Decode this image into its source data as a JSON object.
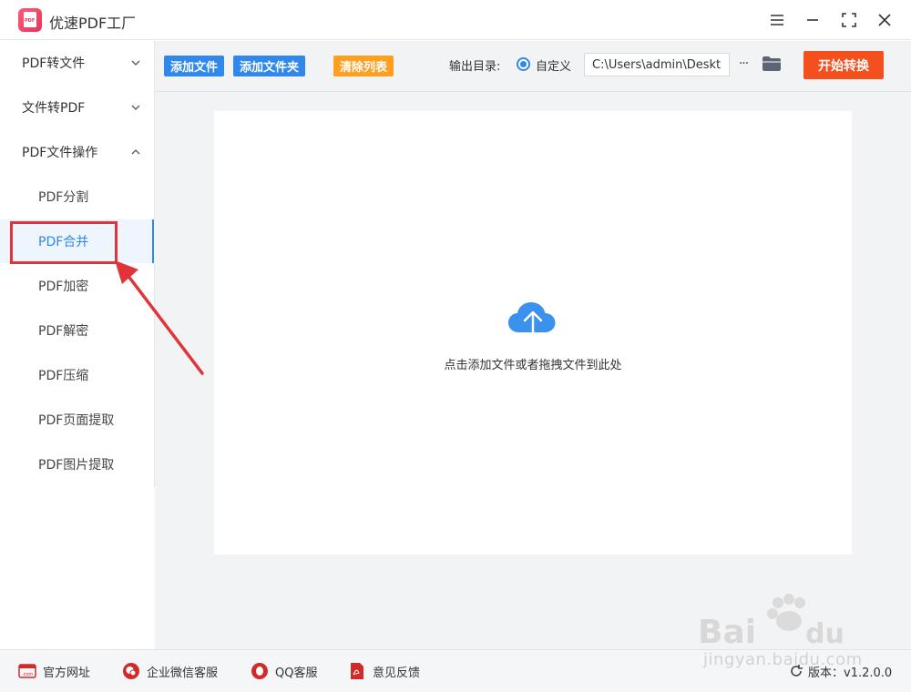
{
  "app": {
    "title": "优速PDF工厂"
  },
  "sidebar": {
    "groups": [
      {
        "label": "PDF转文件",
        "expanded": false
      },
      {
        "label": "文件转PDF",
        "expanded": false
      },
      {
        "label": "PDF文件操作",
        "expanded": true
      }
    ],
    "items": [
      {
        "label": "PDF分割"
      },
      {
        "label": "PDF合并",
        "active": true
      },
      {
        "label": "PDF加密"
      },
      {
        "label": "PDF解密"
      },
      {
        "label": "PDF压缩"
      },
      {
        "label": "PDF页面提取"
      },
      {
        "label": "PDF图片提取"
      }
    ]
  },
  "toolbar": {
    "add_file": "添加文件",
    "add_folder": "添加文件夹",
    "clear_list": "清除列表",
    "output_label": "输出目录:",
    "radio_label": "自定义",
    "output_path": "C:\\Users\\admin\\Desktop",
    "more": "···",
    "start": "开始转换"
  },
  "dropzone": {
    "hint": "点击添加文件或者拖拽文件到此处"
  },
  "footer": {
    "website": "官方网址",
    "wechat": "企业微信客服",
    "qq": "QQ客服",
    "feedback": "意见反馈",
    "version": "版本：v1.2.0.0"
  },
  "watermark": {
    "text": "jingyan.baidu.com"
  },
  "colors": {
    "accent": "#2f88ea",
    "orange": "#ff9e1f",
    "start": "#f4501e",
    "annotation": "#e0333a"
  }
}
